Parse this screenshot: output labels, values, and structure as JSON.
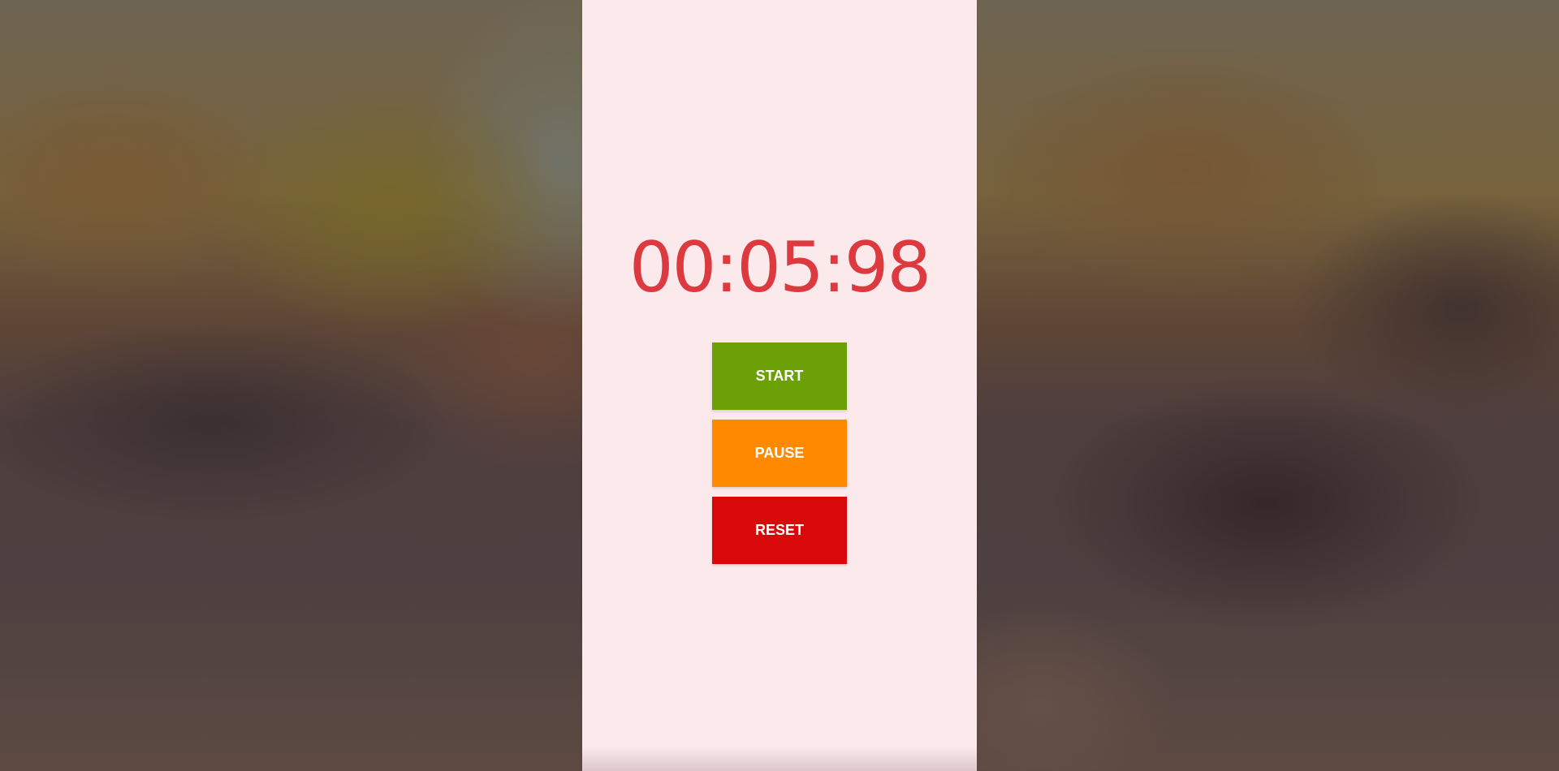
{
  "stopwatch": {
    "display": "00:05:98"
  },
  "buttons": {
    "start_label": "START",
    "pause_label": "PAUSE",
    "reset_label": "RESET"
  },
  "colors": {
    "panel_background": "#fce9eb",
    "display_text": "#dc3a3f",
    "start": "#6ba106",
    "pause": "#ff8900",
    "reset": "#d9080b"
  }
}
